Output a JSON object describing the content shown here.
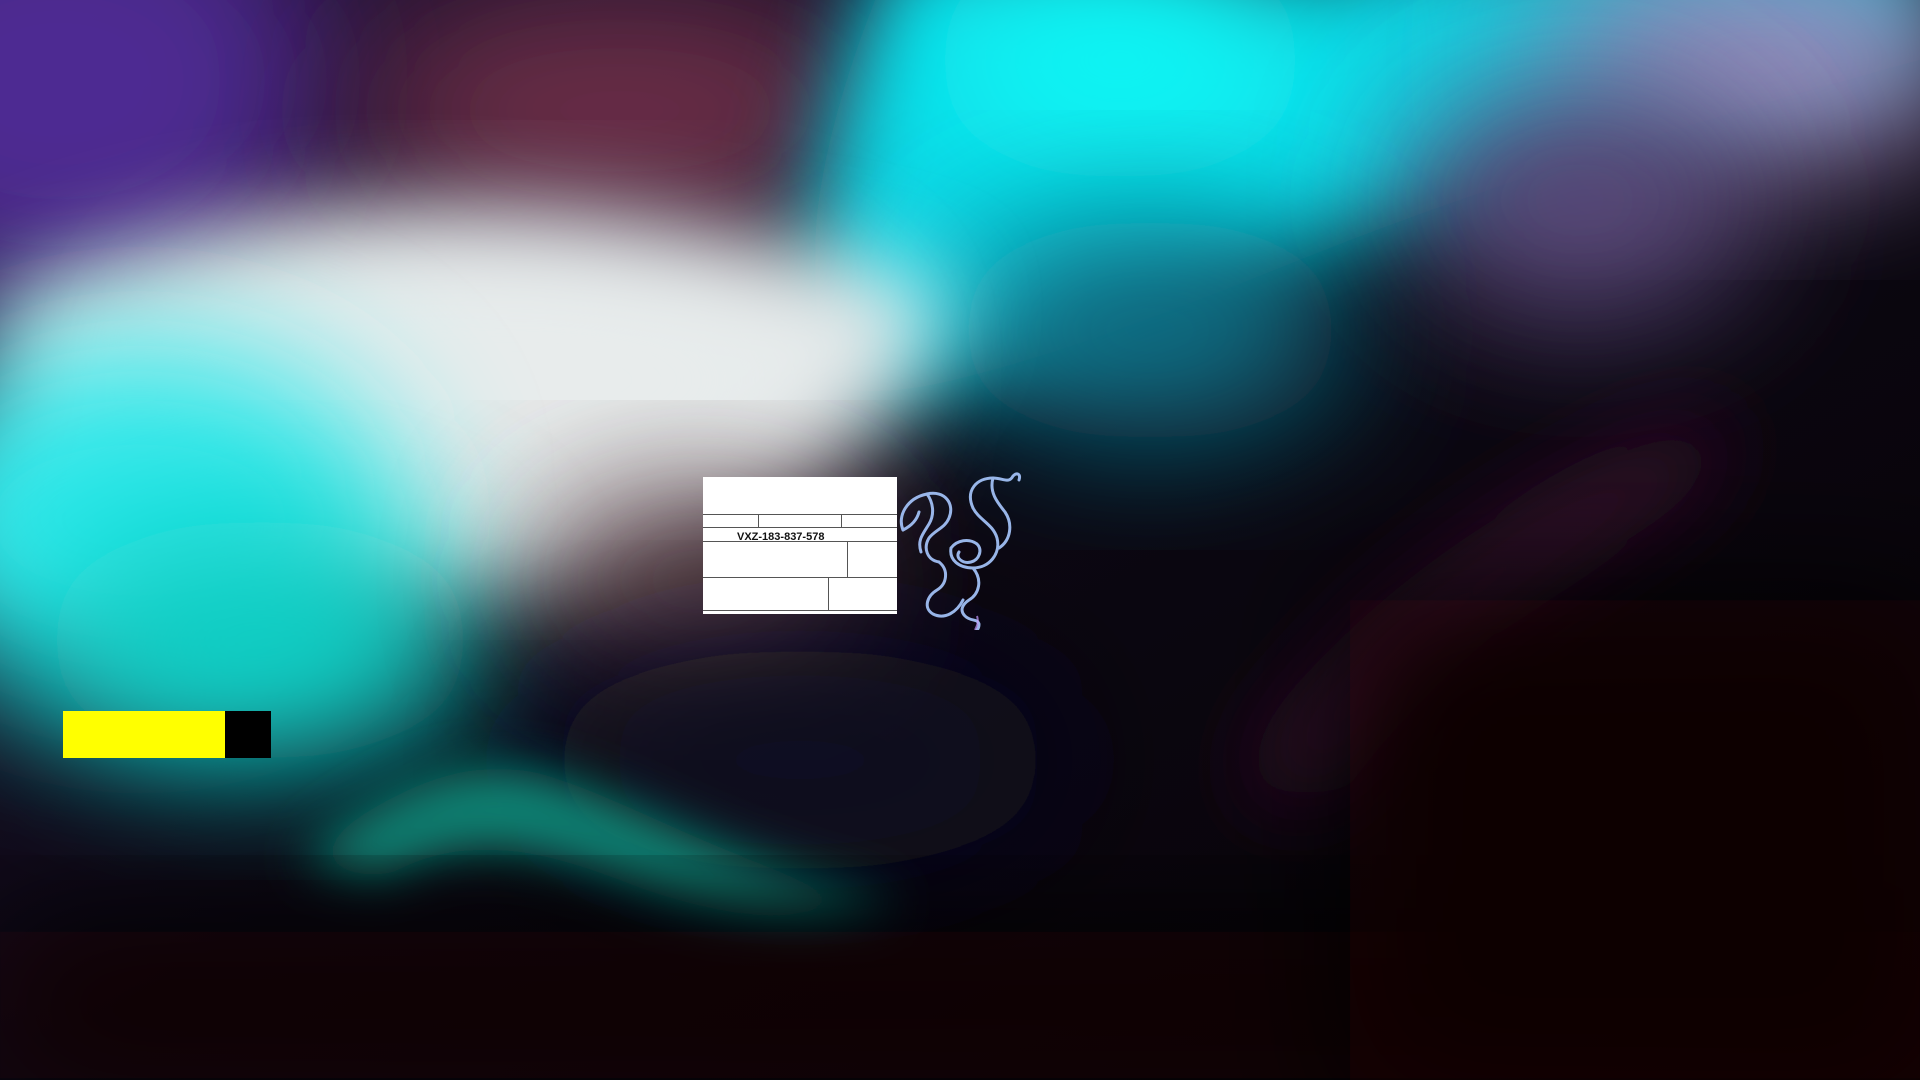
{
  "desktop": {
    "label_window": {
      "code": "VXZ-183-837-578"
    },
    "progress_widget": {
      "progress_fraction": 0.78,
      "fill_color": "#ffff00",
      "track_color": "#000000"
    },
    "logo": {
      "icon": "razer-snake-logo",
      "stroke_color": "#a8c8ff"
    },
    "wallpaper": {
      "colors": [
        "#06f3f0",
        "#e2e8e9",
        "#6a2f47",
        "#4a2a8c",
        "#0a0206",
        "#0bb3a4"
      ]
    }
  }
}
